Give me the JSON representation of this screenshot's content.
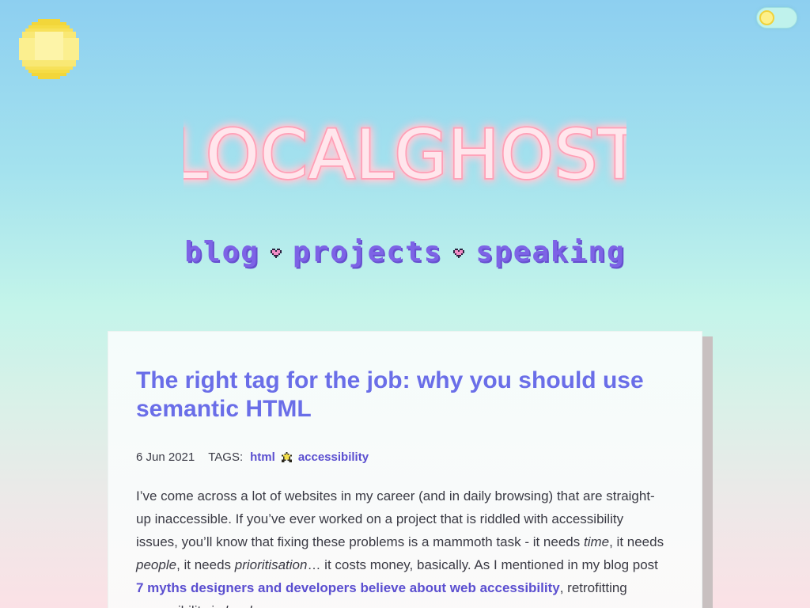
{
  "header": {
    "logo_text": "LOCALGHOST",
    "theme_toggle": "light"
  },
  "nav": {
    "items": [
      {
        "label": "blog"
      },
      {
        "label": "projects"
      },
      {
        "label": "speaking"
      }
    ]
  },
  "article": {
    "title": "The right tag for the job: why you should use semantic HTML",
    "date": "6 Jun 2021",
    "tags_label": "TAGS:",
    "tags": [
      "html",
      "accessibility"
    ],
    "paragraph": {
      "p1": "I’ve come across a lot of websites in my career (and in daily browsing) that are straight-up inaccessible. If you’ve ever worked on a project that is riddled with accessibility issues, you’ll know that fixing these problems is a mammoth task - it needs ",
      "e1": "time",
      "p2": ", it needs ",
      "e2": "people",
      "p3": ", it needs ",
      "e3": "prioritisation",
      "p4": "… it costs money, basically. As I mentioned in my blog post ",
      "link": "7 myths designers and developers believe about web accessibility",
      "p5": ", retrofitting accessibility is ",
      "e4": "hard",
      "p6": "."
    }
  },
  "colors": {
    "accent": "#7d63e6",
    "title": "#6a6ee8",
    "link": "#5b4fd0",
    "neon": "#ff9fb6"
  }
}
